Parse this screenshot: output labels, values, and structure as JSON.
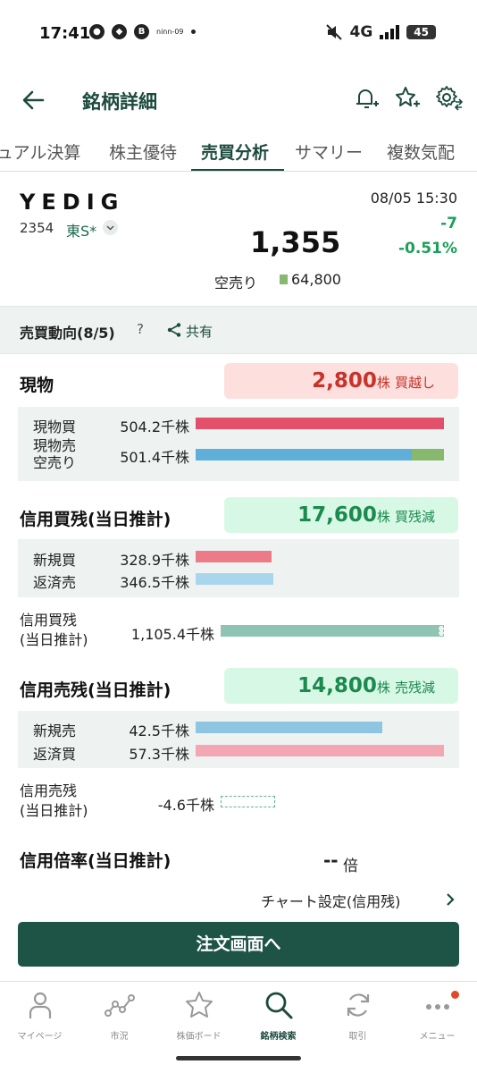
{
  "status_bar": {
    "time": "17:41",
    "network": "4G",
    "battery": "45",
    "tiny_label": "ninn-09"
  },
  "header": {
    "title": "銘柄詳細"
  },
  "tabs": [
    {
      "label": "ュアル決算"
    },
    {
      "label": "株主優待"
    },
    {
      "label": "売買分析",
      "active": true
    },
    {
      "label": "サマリー"
    },
    {
      "label": "複数気配"
    }
  ],
  "stock": {
    "name": "YEDIG",
    "code": "2354",
    "market": "東S*",
    "time": "08/05 15:30",
    "price": "1,355",
    "change": "-7",
    "change_pct": "-0.51%",
    "short_label": "空売り",
    "short_value": "64,800"
  },
  "trend": {
    "title": "売買動向(8/5)",
    "help": "?",
    "share_label": "共有"
  },
  "spot": {
    "title": "現物",
    "summary_value": "2,800",
    "summary_unit": "株",
    "summary_label": "買越し",
    "rows": [
      {
        "label": "現物買",
        "value": "504.2千株",
        "fill": 1.0
      },
      {
        "label_line1": "現物売",
        "label_line2": "空売り",
        "value": "501.4千株",
        "fill": 1.0,
        "short_fraction": 0.129
      }
    ]
  },
  "margin_buy": {
    "title": "信用買残(当日推計)",
    "summary_value": "17,600",
    "summary_unit": "株",
    "summary_label": "買残減",
    "rows": [
      {
        "label": "新規買",
        "value": "328.9千株",
        "fill": 0.305
      },
      {
        "label": "返済売",
        "value": "346.5千株",
        "fill": 0.312
      }
    ],
    "balance_label_line1": "信用買残",
    "balance_label_line2": "(当日推計)",
    "balance_value": "1,105.4千株",
    "balance_fill": 1.0
  },
  "margin_sell": {
    "title": "信用売残(当日推計)",
    "summary_value": "14,800",
    "summary_unit": "株",
    "summary_label": "売残減",
    "rows": [
      {
        "label": "新規売",
        "value": "42.5千株",
        "fill": 0.75
      },
      {
        "label": "返済買",
        "value": "57.3千株",
        "fill": 1.0
      }
    ],
    "balance_label_line1": "信用売残",
    "balance_label_line2": "(当日推計)",
    "balance_value": "-4.6千株",
    "balance_fill": 0.08
  },
  "margin_ratio": {
    "title": "信用倍率(当日推計)",
    "value": "--",
    "unit": "倍"
  },
  "chart_link": {
    "label": "チャート設定(信用残)"
  },
  "order_button": {
    "label": "注文画面へ"
  },
  "bottom_nav": [
    {
      "label": "マイページ",
      "icon": "person-icon"
    },
    {
      "label": "市況",
      "icon": "market-graph-icon"
    },
    {
      "label": "株価ボード",
      "icon": "star-board-icon"
    },
    {
      "label": "銘柄検索",
      "icon": "search-icon",
      "active": true
    },
    {
      "label": "取引",
      "icon": "refresh-trade-icon"
    },
    {
      "label": "メニュー",
      "icon": "more-menu-icon",
      "badge": true
    }
  ],
  "colors": {
    "brand": "#1c4a3e",
    "buy_bar": "#e2506a",
    "sell_bar": "#5eb0d8",
    "short_bar": "#86b86e",
    "new_buy_bar": "#ec7a89",
    "repay_sell_bar": "#a9d6ec",
    "balance_bar": "#8fc4b5",
    "new_sell_bar": "#8ec6e2",
    "repay_buy_bar": "#f2a7b3",
    "up_green": "#1aa05a",
    "down_red": "#c8322a"
  }
}
